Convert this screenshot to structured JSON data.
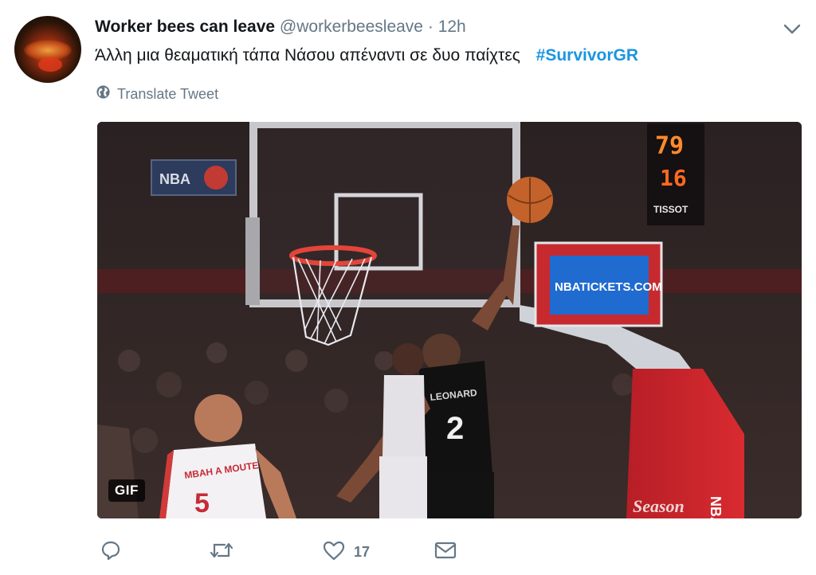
{
  "tweet": {
    "user_name": "Worker bees can leave",
    "handle": "@workerbeesleave",
    "separator": "·",
    "time": "12h",
    "text": "Άλλη μια θεαματική τάπα Νάσου απέναντι σε δυο παίχτες",
    "hashtag": "#SurvivorGR",
    "translate_label": "Translate Tweet",
    "media_badge": "GIF",
    "likes_count": "17"
  },
  "media_scene": {
    "arena_banner": "NBA",
    "board_ad": "NBATICKETS.COM",
    "scoreboard_top": "79",
    "scoreboard_bottom": "16",
    "scoreboard_brand": "TISSOT",
    "player_spurs_name": "LEONARD",
    "player_spurs_number": "2",
    "player_clippers_name": "MBAH A MOUTE",
    "player_clippers_number": "5",
    "stanchion_text": "NBA",
    "stanchion_bottom": "Season"
  },
  "icons": {
    "reply": "reply-icon",
    "retweet": "retweet-icon",
    "like": "heart-icon",
    "message": "envelope-icon",
    "globe": "globe-icon",
    "caret": "chevron-down-icon"
  },
  "colors": {
    "hashtag": "#1b95e0",
    "secondary_text": "#657786",
    "primary_text": "#14171a"
  }
}
